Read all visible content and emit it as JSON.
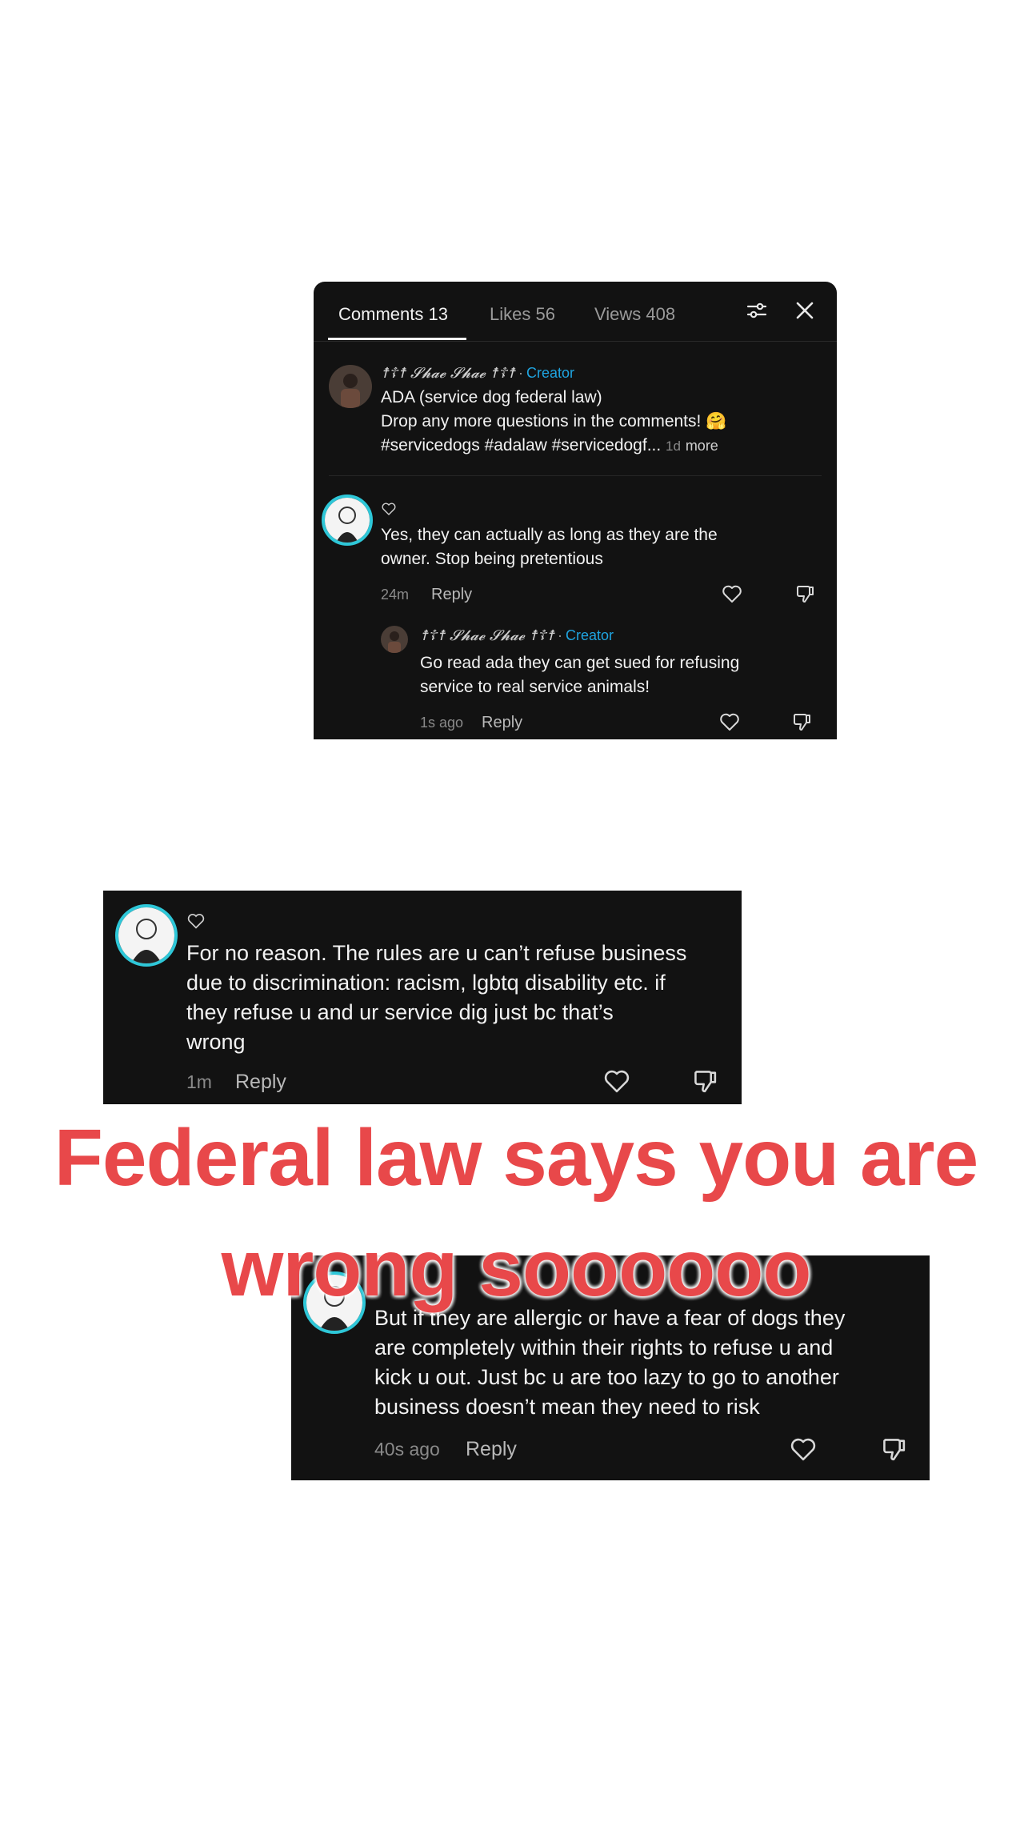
{
  "panel_top": {
    "tabs": [
      {
        "label": "Comments 13"
      },
      {
        "label": "Likes 56"
      },
      {
        "label": "Views 408"
      }
    ],
    "creator_post": {
      "author": "☨☦☨ 𝓢𝓱𝓪𝓮 𝓢𝓱𝓪𝓮 ☨☦☨",
      "badge": "Creator",
      "lines": [
        "ADA (service dog federal law)",
        "Drop any more questions in the comments! 🤗",
        "#servicedogs #adalaw #servicedogf..."
      ],
      "time": "1d",
      "more": "more"
    },
    "comment": {
      "lines": [
        "Yes, they can actually as long as they are the",
        "owner. Stop being pretentious"
      ],
      "time": "24m",
      "reply": "Reply"
    },
    "reply": {
      "author": "☨☦☨ 𝓢𝓱𝓪𝓮 𝓢𝓱𝓪𝓮 ☨☦☨",
      "badge": "Creator",
      "lines": [
        "Go read ada they can get sued for refusing",
        "service to real service animals!"
      ],
      "time": "1s ago",
      "reply": "Reply"
    }
  },
  "panel_middle": {
    "lines": [
      "For no reason. The rules are u can’t refuse business",
      "due to discrimination: racism, lgbtq disability etc. if",
      "they refuse u and ur service dig just bc that’s",
      "wrong"
    ],
    "time": "1m",
    "reply": "Reply"
  },
  "caption": {
    "line1": "Federal law says you are",
    "line2": "wrong soooooo"
  },
  "panel_bottom": {
    "lines": [
      "But if they are allergic or have a fear of dogs they",
      "are completely within their rights to refuse u and",
      "kick u out. Just bc u are too lazy to go to another",
      "business doesn’t mean they need to risk"
    ],
    "time": "40s ago",
    "reply": "Reply"
  },
  "colors": {
    "panel_bg": "#121212",
    "accent_creator": "#1fa4e0",
    "avatar_ring": "#2ec7d8",
    "caption_red": "#e8484a"
  }
}
